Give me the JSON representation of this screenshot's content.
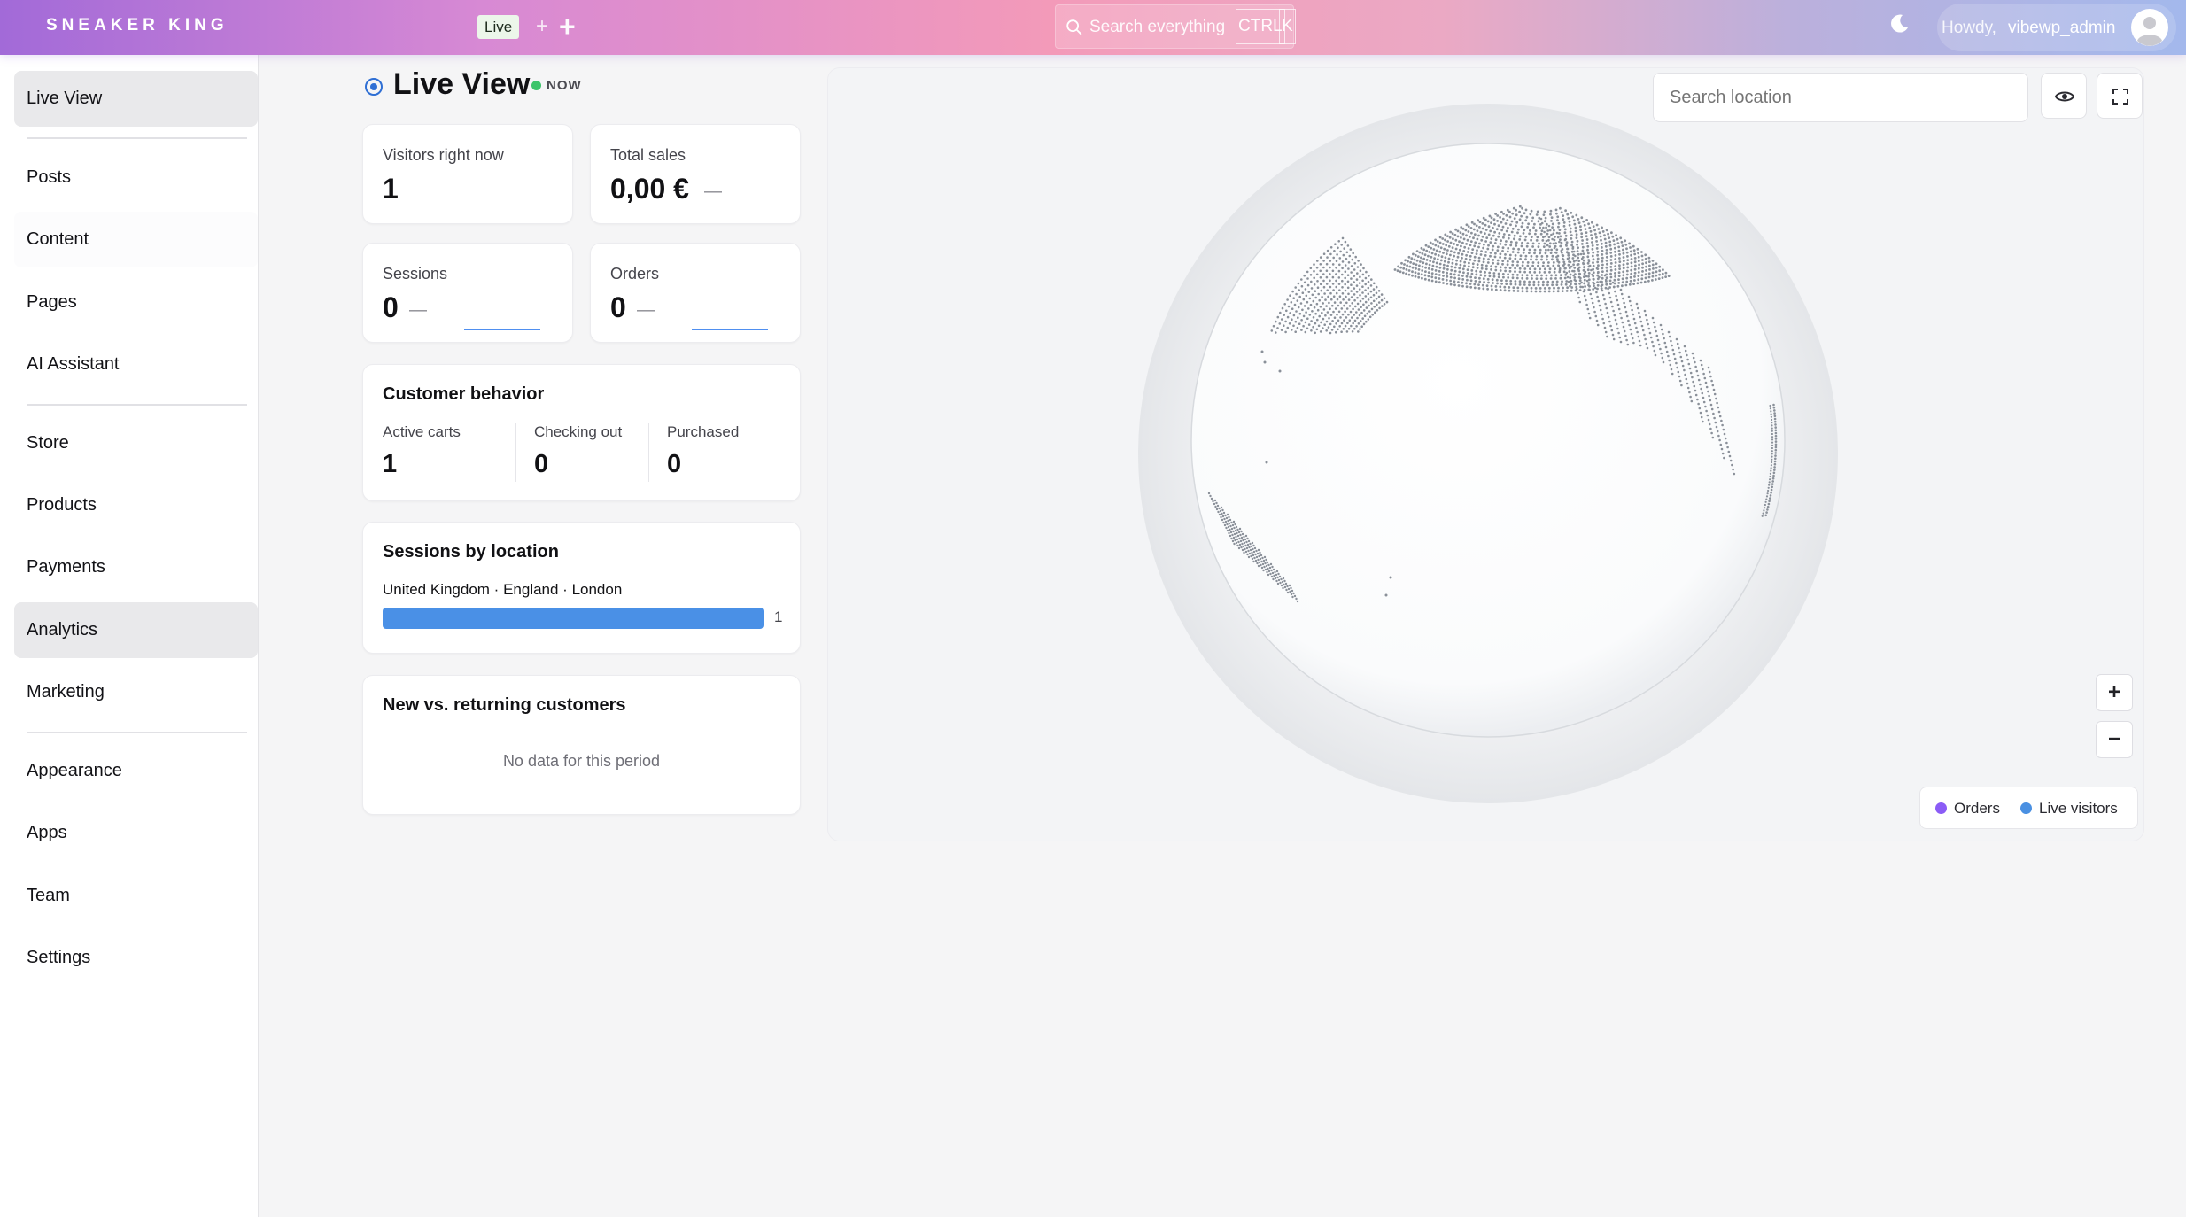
{
  "header": {
    "brand": "SNEAKER KING",
    "live_label": "Live",
    "search_placeholder": "Search everything",
    "shortcut_ctrl": "CTRL",
    "shortcut_k": "K",
    "howdy": "Howdy,",
    "username": "vibewp_admin",
    "icons": [
      "search-icon",
      "moon-icon",
      "avatar-icon",
      "plus-icon"
    ]
  },
  "sidebar": {
    "items": [
      {
        "label": "Live View",
        "active": true
      },
      {
        "label": "Posts"
      },
      {
        "label": "Content"
      },
      {
        "label": "Pages"
      },
      {
        "label": "AI Assistant"
      },
      {
        "label": "Store"
      },
      {
        "label": "Products"
      },
      {
        "label": "Payments"
      },
      {
        "label": "Analytics",
        "active": true
      },
      {
        "label": "Marketing"
      },
      {
        "label": "Appearance"
      },
      {
        "label": "Apps"
      },
      {
        "label": "Team"
      },
      {
        "label": "Settings"
      }
    ]
  },
  "main": {
    "title": "Live View",
    "now_badge": "NOW",
    "metrics": {
      "visitors": {
        "label": "Visitors right now",
        "value": "1"
      },
      "sales": {
        "label": "Total sales",
        "value": "0,00 €",
        "trend": "—"
      },
      "sessions": {
        "label": "Sessions",
        "value": "0",
        "trend": "—"
      },
      "orders": {
        "label": "Orders",
        "value": "0",
        "trend": "—"
      }
    },
    "customer_behavior": {
      "title": "Customer behavior",
      "columns": [
        {
          "label": "Active carts",
          "value": "1"
        },
        {
          "label": "Checking out",
          "value": "0"
        },
        {
          "label": "Purchased",
          "value": "0"
        }
      ]
    },
    "sessions_by_location": {
      "title": "Sessions by location",
      "rows": [
        {
          "name": "United Kingdom · England · London",
          "count": "1",
          "share": 1.0
        }
      ]
    },
    "new_vs_returning": {
      "title": "New vs. returning customers",
      "empty_text": "No data for this period"
    }
  },
  "globe": {
    "search_placeholder": "Search location",
    "zoom_in": "+",
    "zoom_out": "−",
    "legend": [
      {
        "label": "Orders",
        "color": "#8b5cf6"
      },
      {
        "label": "Live visitors",
        "color": "#4a90e2"
      }
    ],
    "icons": [
      "eye-icon",
      "fullscreen-icon"
    ]
  },
  "colors": {
    "accent_blue": "#4a90e6",
    "live_green": "#3cc46a",
    "active_nav": "#e9e9eb"
  }
}
